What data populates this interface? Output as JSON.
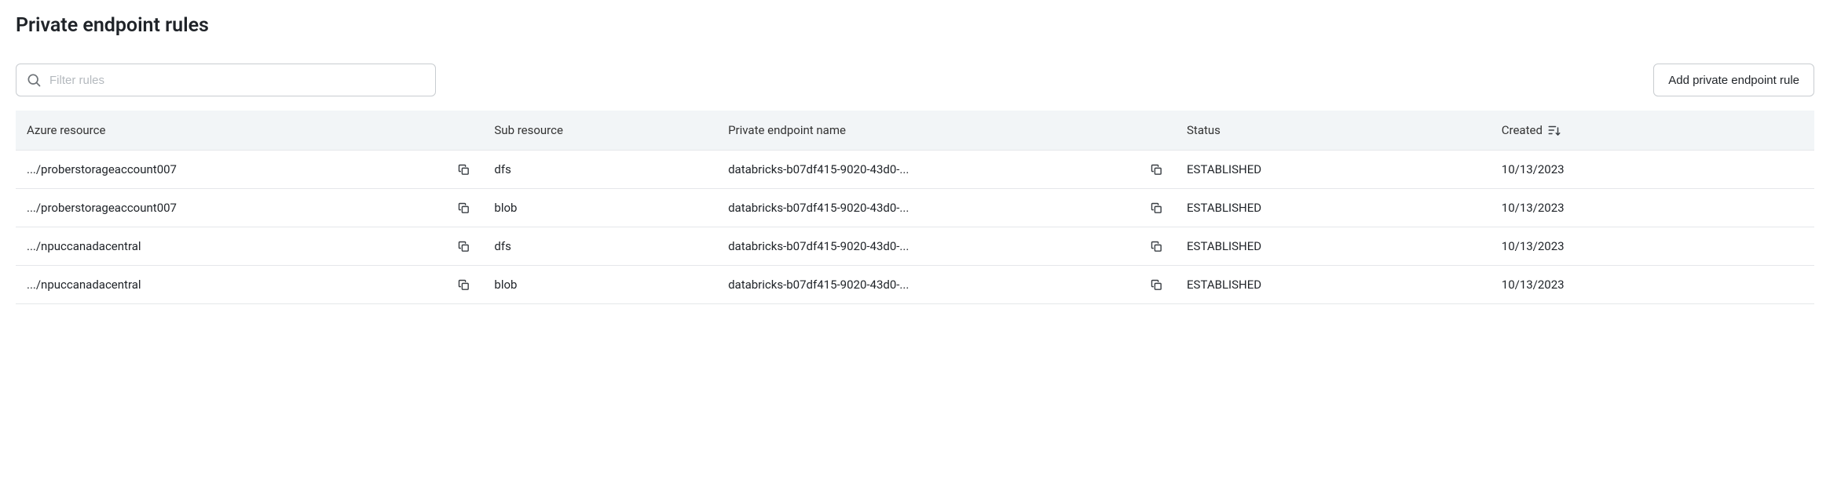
{
  "title": "Private endpoint rules",
  "filter": {
    "placeholder": "Filter rules"
  },
  "actions": {
    "add_label": "Add private endpoint rule"
  },
  "table": {
    "headers": {
      "azure_resource": "Azure resource",
      "sub_resource": "Sub resource",
      "pe_name": "Private endpoint name",
      "status": "Status",
      "created": "Created"
    },
    "rows": [
      {
        "azure_resource": ".../proberstorageaccount007",
        "sub_resource": "dfs",
        "pe_name": "databricks-b07df415-9020-43d0-...",
        "status": "ESTABLISHED",
        "created": "10/13/2023"
      },
      {
        "azure_resource": ".../proberstorageaccount007",
        "sub_resource": "blob",
        "pe_name": "databricks-b07df415-9020-43d0-...",
        "status": "ESTABLISHED",
        "created": "10/13/2023"
      },
      {
        "azure_resource": ".../npuccanadacentral",
        "sub_resource": "dfs",
        "pe_name": "databricks-b07df415-9020-43d0-...",
        "status": "ESTABLISHED",
        "created": "10/13/2023"
      },
      {
        "azure_resource": ".../npuccanadacentral",
        "sub_resource": "blob",
        "pe_name": "databricks-b07df415-9020-43d0-...",
        "status": "ESTABLISHED",
        "created": "10/13/2023"
      }
    ]
  }
}
